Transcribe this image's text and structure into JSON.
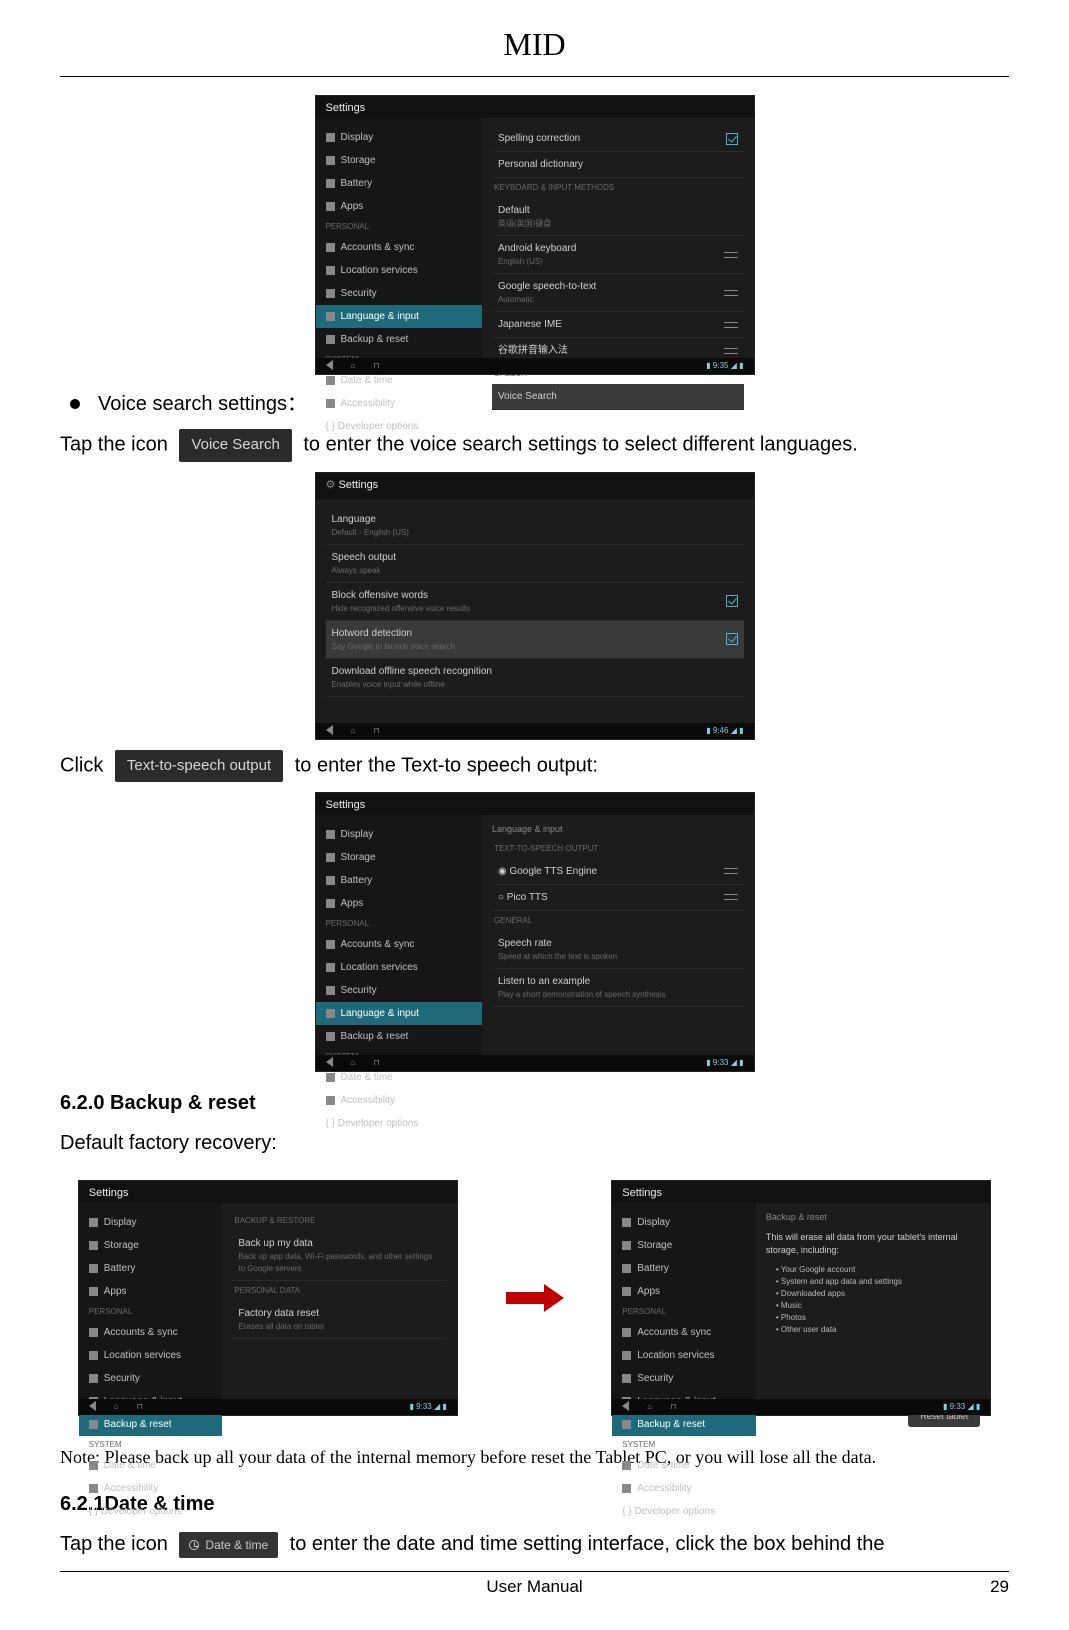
{
  "doc": {
    "header_title": "MID",
    "footer_center": "User Manual",
    "page_number": "29"
  },
  "section_bullet1": "Voice search settings：",
  "para1_pre": "Tap the icon",
  "btn_voice_search": "Voice Search",
  "para1_post": "to enter the voice search settings to select different languages.",
  "para2_pre": "Click",
  "btn_tts": "Text-to-speech output",
  "para2_post": "to enter the Text-to speech output:",
  "heading_backup": "6.2.0 Backup & reset",
  "para_backup": "Default factory recovery:",
  "note_text": "Note: Please back up all your data of the internal memory before reset the Tablet PC, or you will lose all the data.",
  "heading_date": "6.2.1Date & time",
  "para_date_pre": "Tap  the  icon",
  "btn_date": "Date & time",
  "para_date_post": "to  enter  the  date  and  time  setting  interface,  click  the  box  behind  the",
  "shot1": {
    "title": "Settings",
    "sidebar_items": [
      "Display",
      "Storage",
      "Battery",
      "Apps"
    ],
    "sidebar_head1": "PERSONAL",
    "sidebar_items2": [
      "Accounts & sync",
      "Location services",
      "Security"
    ],
    "sidebar_hl": "Language & input",
    "sidebar_items3": [
      "Backup & reset"
    ],
    "sidebar_head2": "SYSTEM",
    "sidebar_items4": [
      "Date & time",
      "Accessibility",
      "{ } Developer options"
    ],
    "main_item1": {
      "t": "Spelling correction"
    },
    "main_item2": {
      "t": "Personal dictionary"
    },
    "main_head1": "KEYBOARD & INPUT METHODS",
    "main_item3": {
      "t": "Default",
      "s": "英语(英国)键盘"
    },
    "main_item4": {
      "t": "Android keyboard",
      "s": "English (US)"
    },
    "main_item5": {
      "t": "Google speech-to-text",
      "s": "Automatic"
    },
    "main_item6": {
      "t": "Japanese IME",
      "s": ""
    },
    "main_item7": {
      "t": "谷歌拼音输入法",
      "s": ""
    },
    "main_head2": "SPEECH",
    "main_item8": {
      "t": "Voice Search"
    },
    "time": "9:35"
  },
  "shot2": {
    "title": "Settings",
    "items": [
      {
        "t": "Language",
        "s": "Default - English (US)"
      },
      {
        "t": "Speech output",
        "s": "Always speak"
      },
      {
        "t": "Block offensive words",
        "s": "Hide recognized offensive voice results",
        "check": true
      },
      {
        "t": "Hotword detection",
        "s": "Say Google to launch voice search",
        "check": true
      },
      {
        "t": "Download offline speech recognition",
        "s": "Enables voice input while offline"
      }
    ],
    "time": "9:46"
  },
  "shot3": {
    "title": "Settings",
    "sidebar_items": [
      "Display",
      "Storage",
      "Battery",
      "Apps"
    ],
    "sidebar_head1": "PERSONAL",
    "sidebar_items2": [
      "Accounts & sync",
      "Location services",
      "Security"
    ],
    "sidebar_hl": "Language & input",
    "sidebar_items3": [
      "Backup & reset"
    ],
    "sidebar_head2": "SYSTEM",
    "sidebar_items4": [
      "Date & time",
      "Accessibility",
      "{ } Developer options"
    ],
    "main_sub": "Language & input",
    "main_head1": "TEXT-TO-SPEECH OUTPUT",
    "main_item1": {
      "t": "Google TTS Engine"
    },
    "main_item2": {
      "t": "Pico TTS"
    },
    "main_head2": "GENERAL",
    "main_item3": {
      "t": "Speech rate",
      "s": "Speed at which the text is spoken"
    },
    "main_item4": {
      "t": "Listen to an example",
      "s": "Play a short demonstration of speech synthesis"
    },
    "time": "9:33"
  },
  "shot4": {
    "title": "Settings",
    "sidebar_items": [
      "Display",
      "Storage",
      "Battery",
      "Apps"
    ],
    "sidebar_head1": "PERSONAL",
    "sidebar_items2": [
      "Accounts & sync",
      "Location services",
      "Security",
      "Language & input"
    ],
    "sidebar_hl": "Backup & reset",
    "sidebar_head2": "SYSTEM",
    "sidebar_items4": [
      "Date & time",
      "Accessibility",
      "{ } Developer options"
    ],
    "main_head1": "BACKUP & RESTORE",
    "main_item1": {
      "t": "Back up my data",
      "s": "Back up app data, Wi-Fi passwords, and other settings to Google servers"
    },
    "main_head2": "PERSONAL DATA",
    "main_item2": {
      "t": "Factory data reset",
      "s": "Erases all data on tablet"
    },
    "time": "9:33"
  },
  "shot5": {
    "title": "Settings",
    "sidebar_items": [
      "Display",
      "Storage",
      "Battery",
      "Apps"
    ],
    "sidebar_head1": "PERSONAL",
    "sidebar_items2": [
      "Accounts & sync",
      "Location services",
      "Security",
      "Language & input"
    ],
    "sidebar_hl": "Backup & reset",
    "sidebar_head2": "SYSTEM",
    "sidebar_items4": [
      "Date & time",
      "Accessibility",
      "{ } Developer options"
    ],
    "main_sub": "Backup & reset",
    "para": "This will erase all data from your tablet's internal storage, including:",
    "bullets": [
      "Your Google account",
      "System and app data and settings",
      "Downloaded apps",
      "Music",
      "Photos",
      "Other user data"
    ],
    "reset_btn": "Reset tablet",
    "time": "9:33"
  }
}
